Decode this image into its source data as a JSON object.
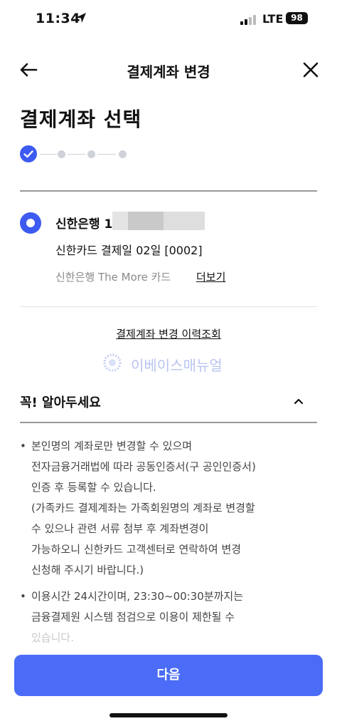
{
  "status_bar": {
    "time": "11:34",
    "network": "LTE",
    "battery": "98",
    "icons": [
      "location-arrow-icon",
      "signal-icon"
    ]
  },
  "header": {
    "title": "결제계좌 변경",
    "icons": [
      "back-arrow-icon",
      "close-icon"
    ]
  },
  "page_title": "결제계좌 선택",
  "stepper": {
    "current_step": 1,
    "total_steps": 5,
    "accent_color": "#3d5af1"
  },
  "account": {
    "bank_name": "신한은행 1",
    "card_info": "신한카드 결제일 02일 [0002]",
    "card_product": "신한은행 The More 카드",
    "more_link": "더보기",
    "selected": true
  },
  "history_link": "결제계좌 변경 이력조회",
  "watermark": "이베이스매뉴얼",
  "notice": {
    "title": "꼭! 알아두세요",
    "items": [
      {
        "bullet": "•",
        "lines": [
          "본인명의 계좌로만 변경할 수 있으며",
          "전자금융거래법에 따라 공동인증서(구 공인인증서)",
          "인증 후 등록할 수 있습니다.",
          "(가족카드 결제계좌는 가족회원명의 계좌로 변경할",
          "수 있으나 관련 서류 첨부 후 계좌변경이",
          "가능하오니 신한카드 고객센터로 연락하여 변경",
          "신청해 주시기 바랍니다.)"
        ]
      },
      {
        "bullet": "•",
        "lines": [
          "이용시간 24시간이며, 23:30~00:30분까지는",
          "금융결제원 시스템 점검으로 이용이 제한될 수",
          "있습니다."
        ]
      }
    ]
  },
  "next_button": {
    "label": "다음",
    "color": "#4a6cf6"
  }
}
